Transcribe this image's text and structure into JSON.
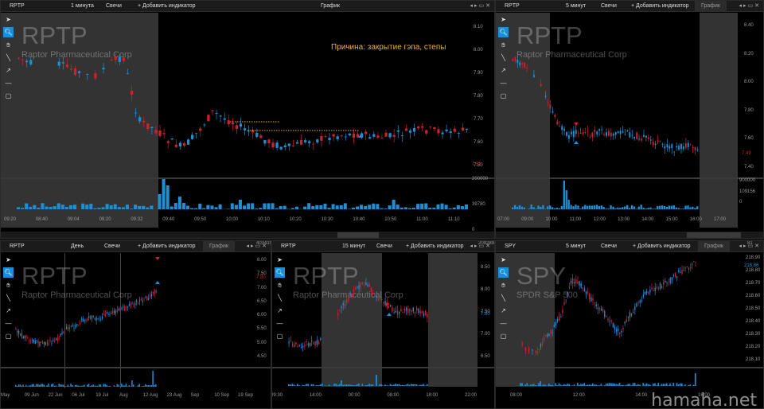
{
  "common": {
    "add_indicator": "+ Добавить индикатор",
    "candles": "Свечи",
    "chart_tab": "График",
    "colors": {
      "up": "#1e8fd5",
      "down": "#d0202f",
      "volume": "#1e8fd5",
      "session_bg": "#333333",
      "bg": "#000000"
    }
  },
  "panels": {
    "p1": {
      "ticker": "RPTP",
      "interval": "1 минута",
      "watermark_symbol": "RPTP",
      "watermark_name": "Raptor Pharmaceutical Corp",
      "annotation": "Причина: закрытие гэпа, степы",
      "price_ticks": [
        "8.10",
        "8.00",
        "7.90",
        "7.80",
        "7.70",
        "7.60",
        "7.50"
      ],
      "price_last": "7.58",
      "vol_ticks": [
        "200000",
        "39780",
        "0"
      ],
      "time_ticks": [
        "09:20",
        "08:40",
        "09:04",
        "09:20",
        "09:32",
        "09:40",
        "09:50",
        "10:00",
        "10:10",
        "10:20",
        "10:30",
        "10:40",
        "10:50",
        "11:00",
        "11:10"
      ]
    },
    "p2": {
      "ticker": "RPTP",
      "interval": "5 минут",
      "watermark_symbol": "RPTP",
      "watermark_name": "Raptor Pharmaceutical Corp",
      "price_ticks": [
        "8.40",
        "8.20",
        "8.00",
        "7.80",
        "7.60",
        "7.40"
      ],
      "price_last": "7.49",
      "vol_ticks": [
        "900000",
        "109156",
        "0"
      ],
      "time_ticks": [
        "07:00",
        "09:00",
        "10:00",
        "11:00",
        "12:00",
        "13:00",
        "14:00",
        "15:00",
        "16:00",
        "17:00"
      ]
    },
    "p3": {
      "ticker": "RPTP",
      "interval": "День",
      "watermark_symbol": "RPTP",
      "watermark_name": "Raptor Pharmaceutical Corp",
      "price_ticks": [
        "8.00",
        "7.50",
        "7.00",
        "6.50",
        "6.00",
        "5.50",
        "5.00",
        "4.50"
      ],
      "price_last": "7.80",
      "vol_ticks": [
        "403419"
      ],
      "time_ticks": [
        "May",
        "09 Jun",
        "22 Jun",
        "06 Jul",
        "19 Jul",
        "Aug",
        "12 Aug",
        "23 Aug",
        "Sep",
        "10 Sep",
        "19 Sep"
      ]
    },
    "p4": {
      "ticker": "RPTP",
      "interval": "15 минут",
      "watermark_symbol": "RPTP",
      "watermark_name": "Raptor Pharmaceutical Corp",
      "price_ticks": [
        "8.50",
        "8.00",
        "7.50",
        "7.00",
        "6.50"
      ],
      "price_last": "7.80",
      "vol_ticks": [
        "209289"
      ],
      "time_ticks": [
        "09:30",
        "14:00",
        "00:00",
        "08:00",
        "18:00",
        "22:00"
      ]
    },
    "p5": {
      "ticker": "SPY",
      "interval": "5 минут",
      "watermark_symbol": "SPY",
      "watermark_name": "SPDR S&P 500",
      "price_ticks": [
        "218.90",
        "218.80",
        "218.70",
        "218.60",
        "218.50",
        "218.40",
        "218.30",
        "218.20",
        "218.10"
      ],
      "price_last": "218.86",
      "vol_ticks": [
        "81"
      ],
      "time_ticks": [
        "08:00",
        "12:00",
        "14:00",
        "16:00"
      ]
    }
  },
  "brand": "hamaha.net",
  "toolbar_icons": [
    "cursor-icon",
    "magnifier-icon",
    "hand-icon",
    "line-icon",
    "arrow-icon",
    "hline-icon",
    "rect-icon"
  ]
}
